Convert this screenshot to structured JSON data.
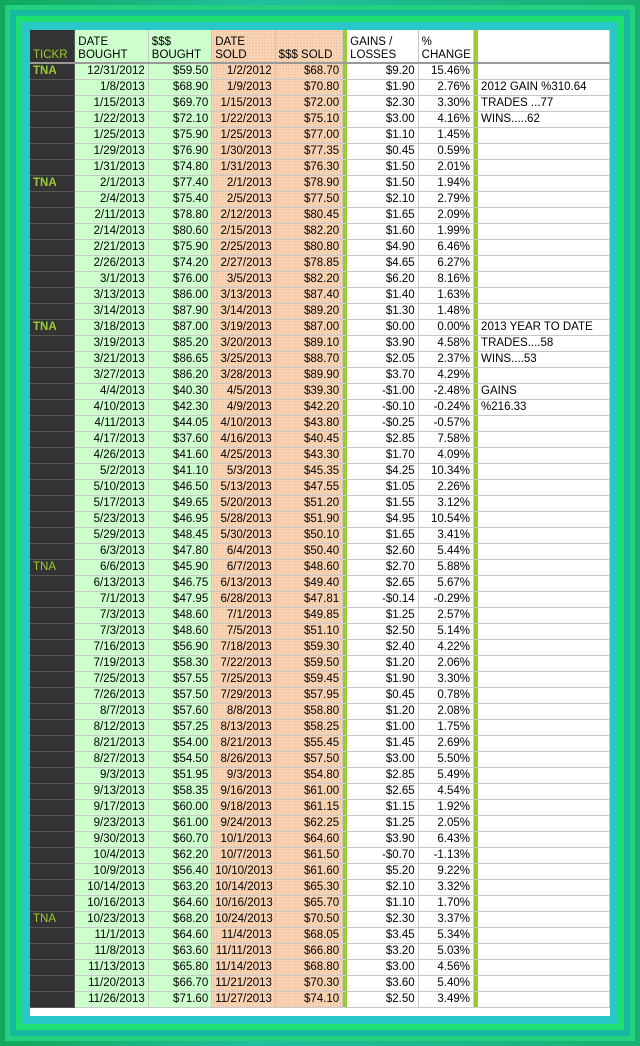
{
  "headers": {
    "ticker": "TICKR",
    "date_bought": "DATE BOUGHT",
    "bought": "$$$ BOUGHT",
    "date_sold": "DATE SOLD",
    "sold": "$$$ SOLD",
    "gains": "GAINS / LOSSES",
    "change": "% CHANGE"
  },
  "colors": {
    "ticker_bg": "#333333",
    "ticker_text": "#9acd32",
    "bought_bg": "#ccffcc",
    "sold_bg": "#fcd5b4",
    "separator": "#9acd32"
  },
  "rows": [
    {
      "t": "TNA",
      "db": "12/31/2012",
      "b": "$59.50",
      "ds": "1/2/2012",
      "s": "$68.70",
      "g": "$9.20",
      "c": "15.46%",
      "n": ""
    },
    {
      "t": "",
      "db": "1/8/2013",
      "b": "$68.90",
      "ds": "1/9/2013",
      "s": "$70.80",
      "g": "$1.90",
      "c": "2.76%",
      "n": "2012 GAIN %310.64"
    },
    {
      "t": "",
      "db": "1/15/2013",
      "b": "$69.70",
      "ds": "1/15/2013",
      "s": "$72.00",
      "g": "$2.30",
      "c": "3.30%",
      "n": "TRADES ...77"
    },
    {
      "t": "",
      "db": "1/22/2013",
      "b": "$72.10",
      "ds": "1/22/2013",
      "s": "$75.10",
      "g": "$3.00",
      "c": "4.16%",
      "n": "WINS.....62"
    },
    {
      "t": "",
      "db": "1/25/2013",
      "b": "$75.90",
      "ds": "1/25/2013",
      "s": "$77.00",
      "g": "$1.10",
      "c": "1.45%",
      "n": ""
    },
    {
      "t": "",
      "db": "1/29/2013",
      "b": "$76.90",
      "ds": "1/30/2013",
      "s": "$77.35",
      "g": "$0.45",
      "c": "0.59%",
      "n": ""
    },
    {
      "t": "",
      "db": "1/31/2013",
      "b": "$74.80",
      "ds": "1/31/2013",
      "s": "$76.30",
      "g": "$1.50",
      "c": "2.01%",
      "n": ""
    },
    {
      "t": "TNA",
      "db": "2/1/2013",
      "b": "$77.40",
      "ds": "2/1/2013",
      "s": "$78.90",
      "g": "$1.50",
      "c": "1.94%",
      "n": ""
    },
    {
      "t": "",
      "db": "2/4/2013",
      "b": "$75.40",
      "ds": "2/5/2013",
      "s": "$77.50",
      "g": "$2.10",
      "c": "2.79%",
      "n": ""
    },
    {
      "t": "",
      "db": "2/11/2013",
      "b": "$78.80",
      "ds": "2/12/2013",
      "s": "$80.45",
      "g": "$1.65",
      "c": "2.09%",
      "n": ""
    },
    {
      "t": "",
      "db": "2/14/2013",
      "b": "$80.60",
      "ds": "2/15/2013",
      "s": "$82.20",
      "g": "$1.60",
      "c": "1.99%",
      "n": ""
    },
    {
      "t": "",
      "db": "2/21/2013",
      "b": "$75.90",
      "ds": "2/25/2013",
      "s": "$80.80",
      "g": "$4.90",
      "c": "6.46%",
      "n": ""
    },
    {
      "t": "",
      "db": "2/26/2013",
      "b": "$74.20",
      "ds": "2/27/2013",
      "s": "$78.85",
      "g": "$4.65",
      "c": "6.27%",
      "n": ""
    },
    {
      "t": "",
      "db": "3/1/2013",
      "b": "$76.00",
      "ds": "3/5/2013",
      "s": "$82.20",
      "g": "$6.20",
      "c": "8.16%",
      "n": ""
    },
    {
      "t": "",
      "db": "3/13/2013",
      "b": "$86.00",
      "ds": "3/13/2013",
      "s": "$87.40",
      "g": "$1.40",
      "c": "1.63%",
      "n": ""
    },
    {
      "t": "",
      "db": "3/14/2013",
      "b": "$87.90",
      "ds": "3/14/2013",
      "s": "$89.20",
      "g": "$1.30",
      "c": "1.48%",
      "n": ""
    },
    {
      "t": "TNA",
      "db": "3/18/2013",
      "b": "$87.00",
      "ds": "3/19/2013",
      "s": "$87.00",
      "g": "$0.00",
      "c": "0.00%",
      "n": "2013 YEAR TO DATE"
    },
    {
      "t": "",
      "db": "3/19/2013",
      "b": "$85.20",
      "ds": "3/20/2013",
      "s": "$89.10",
      "g": "$3.90",
      "c": "4.58%",
      "n": "TRADES....58"
    },
    {
      "t": "",
      "db": "3/21/2013",
      "b": "$86.65",
      "ds": "3/25/2013",
      "s": "$88.70",
      "g": "$2.05",
      "c": "2.37%",
      "n": "WINS....53"
    },
    {
      "t": "",
      "db": "3/27/2013",
      "b": "$86.20",
      "ds": "3/28/2013",
      "s": "$89.90",
      "g": "$3.70",
      "c": "4.29%",
      "n": ""
    },
    {
      "t": "",
      "db": "4/4/2013",
      "b": "$40.30",
      "ds": "4/5/2013",
      "s": "$39.30",
      "g": "-$1.00",
      "c": "-2.48%",
      "n": "GAINS"
    },
    {
      "t": "",
      "db": "4/10/2013",
      "b": "$42.30",
      "ds": "4/9/2013",
      "s": "$42.20",
      "g": "-$0.10",
      "c": "-0.24%",
      "n": "%216.33"
    },
    {
      "t": "",
      "db": "4/11/2013",
      "b": "$44.05",
      "ds": "4/10/2013",
      "s": "$43.80",
      "g": "-$0.25",
      "c": "-0.57%",
      "n": ""
    },
    {
      "t": "",
      "db": "4/17/2013",
      "b": "$37.60",
      "ds": "4/16/2013",
      "s": "$40.45",
      "g": "$2.85",
      "c": "7.58%",
      "n": ""
    },
    {
      "t": "",
      "db": "4/26/2013",
      "b": "$41.60",
      "ds": "4/25/2013",
      "s": "$43.30",
      "g": "$1.70",
      "c": "4.09%",
      "n": ""
    },
    {
      "t": "",
      "db": "5/2/2013",
      "b": "$41.10",
      "ds": "5/3/2013",
      "s": "$45.35",
      "g": "$4.25",
      "c": "10.34%",
      "n": ""
    },
    {
      "t": "",
      "db": "5/10/2013",
      "b": "$46.50",
      "ds": "5/13/2013",
      "s": "$47.55",
      "g": "$1.05",
      "c": "2.26%",
      "n": ""
    },
    {
      "t": "",
      "db": "5/17/2013",
      "b": "$49.65",
      "ds": "5/20/2013",
      "s": "$51.20",
      "g": "$1.55",
      "c": "3.12%",
      "n": ""
    },
    {
      "t": "",
      "db": "5/23/2013",
      "b": "$46.95",
      "ds": "5/28/2013",
      "s": "$51.90",
      "g": "$4.95",
      "c": "10.54%",
      "n": ""
    },
    {
      "t": "",
      "db": "5/29/2013",
      "b": "$48.45",
      "ds": "5/30/2013",
      "s": "$50.10",
      "g": "$1.65",
      "c": "3.41%",
      "n": ""
    },
    {
      "t": "",
      "db": "6/3/2013",
      "b": "$47.80",
      "ds": "6/4/2013",
      "s": "$50.40",
      "g": "$2.60",
      "c": "5.44%",
      "n": ""
    },
    {
      "t": "TNA",
      "db": "6/6/2013",
      "b": "$45.90",
      "ds": "6/7/2013",
      "s": "$48.60",
      "g": "$2.70",
      "c": "5.88%",
      "n": "",
      "light": true
    },
    {
      "t": "",
      "db": "6/13/2013",
      "b": "$46.75",
      "ds": "6/13/2013",
      "s": "$49.40",
      "g": "$2.65",
      "c": "5.67%",
      "n": ""
    },
    {
      "t": "",
      "db": "7/1/2013",
      "b": "$47.95",
      "ds": "6/28/2013",
      "s": "$47.81",
      "g": "-$0.14",
      "c": "-0.29%",
      "n": ""
    },
    {
      "t": "",
      "db": "7/3/2013",
      "b": "$48.60",
      "ds": "7/1/2013",
      "s": "$49.85",
      "g": "$1.25",
      "c": "2.57%",
      "n": ""
    },
    {
      "t": "",
      "db": "7/3/2013",
      "b": "$48.60",
      "ds": "7/5/2013",
      "s": "$51.10",
      "g": "$2.50",
      "c": "5.14%",
      "n": ""
    },
    {
      "t": "",
      "db": "7/16/2013",
      "b": "$56.90",
      "ds": "7/18/2013",
      "s": "$59.30",
      "g": "$2.40",
      "c": "4.22%",
      "n": ""
    },
    {
      "t": "",
      "db": "7/19/2013",
      "b": "$58.30",
      "ds": "7/22/2013",
      "s": "$59.50",
      "g": "$1.20",
      "c": "2.06%",
      "n": ""
    },
    {
      "t": "",
      "db": "7/25/2013",
      "b": "$57.55",
      "ds": "7/25/2013",
      "s": "$59.45",
      "g": "$1.90",
      "c": "3.30%",
      "n": ""
    },
    {
      "t": "",
      "db": "7/26/2013",
      "b": "$57.50",
      "ds": "7/29/2013",
      "s": "$57.95",
      "g": "$0.45",
      "c": "0.78%",
      "n": ""
    },
    {
      "t": "",
      "db": "8/7/2013",
      "b": "$57.60",
      "ds": "8/8/2013",
      "s": "$58.80",
      "g": "$1.20",
      "c": "2.08%",
      "n": ""
    },
    {
      "t": "",
      "db": "8/12/2013",
      "b": "$57.25",
      "ds": "8/13/2013",
      "s": "$58.25",
      "g": "$1.00",
      "c": "1.75%",
      "n": ""
    },
    {
      "t": "",
      "db": "8/21/2013",
      "b": "$54.00",
      "ds": "8/21/2013",
      "s": "$55.45",
      "g": "$1.45",
      "c": "2.69%",
      "n": ""
    },
    {
      "t": "",
      "db": "8/27/2013",
      "b": "$54.50",
      "ds": "8/26/2013",
      "s": "$57.50",
      "g": "$3.00",
      "c": "5.50%",
      "n": ""
    },
    {
      "t": "",
      "db": "9/3/2013",
      "b": "$51.95",
      "ds": "9/3/2013",
      "s": "$54.80",
      "g": "$2.85",
      "c": "5.49%",
      "n": ""
    },
    {
      "t": "",
      "db": "9/13/2013",
      "b": "$58.35",
      "ds": "9/16/2013",
      "s": "$61.00",
      "g": "$2.65",
      "c": "4.54%",
      "n": ""
    },
    {
      "t": "",
      "db": "9/17/2013",
      "b": "$60.00",
      "ds": "9/18/2013",
      "s": "$61.15",
      "g": "$1.15",
      "c": "1.92%",
      "n": ""
    },
    {
      "t": "",
      "db": "9/23/2013",
      "b": "$61.00",
      "ds": "9/24/2013",
      "s": "$62.25",
      "g": "$1.25",
      "c": "2.05%",
      "n": ""
    },
    {
      "t": "",
      "db": "9/30/2013",
      "b": "$60.70",
      "ds": "10/1/2013",
      "s": "$64.60",
      "g": "$3.90",
      "c": "6.43%",
      "n": ""
    },
    {
      "t": "",
      "db": "10/4/2013",
      "b": "$62.20",
      "ds": "10/7/2013",
      "s": "$61.50",
      "g": "-$0.70",
      "c": "-1.13%",
      "n": ""
    },
    {
      "t": "",
      "db": "10/9/2013",
      "b": "$56.40",
      "ds": "10/10/2013",
      "s": "$61.60",
      "g": "$5.20",
      "c": "9.22%",
      "n": ""
    },
    {
      "t": "",
      "db": "10/14/2013",
      "b": "$63.20",
      "ds": "10/14/2013",
      "s": "$65.30",
      "g": "$2.10",
      "c": "3.32%",
      "n": ""
    },
    {
      "t": "",
      "db": "10/16/2013",
      "b": "$64.60",
      "ds": "10/16/2013",
      "s": "$65.70",
      "g": "$1.10",
      "c": "1.70%",
      "n": ""
    },
    {
      "t": "TNA",
      "db": "10/23/2013",
      "b": "$68.20",
      "ds": "10/24/2013",
      "s": "$70.50",
      "g": "$2.30",
      "c": "3.37%",
      "n": "",
      "light": true
    },
    {
      "t": "",
      "db": "11/1/2013",
      "b": "$64.60",
      "ds": "11/4/2013",
      "s": "$68.05",
      "g": "$3.45",
      "c": "5.34%",
      "n": ""
    },
    {
      "t": "",
      "db": "11/8/2013",
      "b": "$63.60",
      "ds": "11/11/2013",
      "s": "$66.80",
      "g": "$3.20",
      "c": "5.03%",
      "n": ""
    },
    {
      "t": "",
      "db": "11/13/2013",
      "b": "$65.80",
      "ds": "11/14/2013",
      "s": "$68.80",
      "g": "$3.00",
      "c": "4.56%",
      "n": ""
    },
    {
      "t": "",
      "db": "11/20/2013",
      "b": "$66.70",
      "ds": "11/21/2013",
      "s": "$70.30",
      "g": "$3.60",
      "c": "5.40%",
      "n": ""
    },
    {
      "t": "",
      "db": "11/26/2013",
      "b": "$71.60",
      "ds": "11/27/2013",
      "s": "$74.10",
      "g": "$2.50",
      "c": "3.49%",
      "n": ""
    }
  ]
}
